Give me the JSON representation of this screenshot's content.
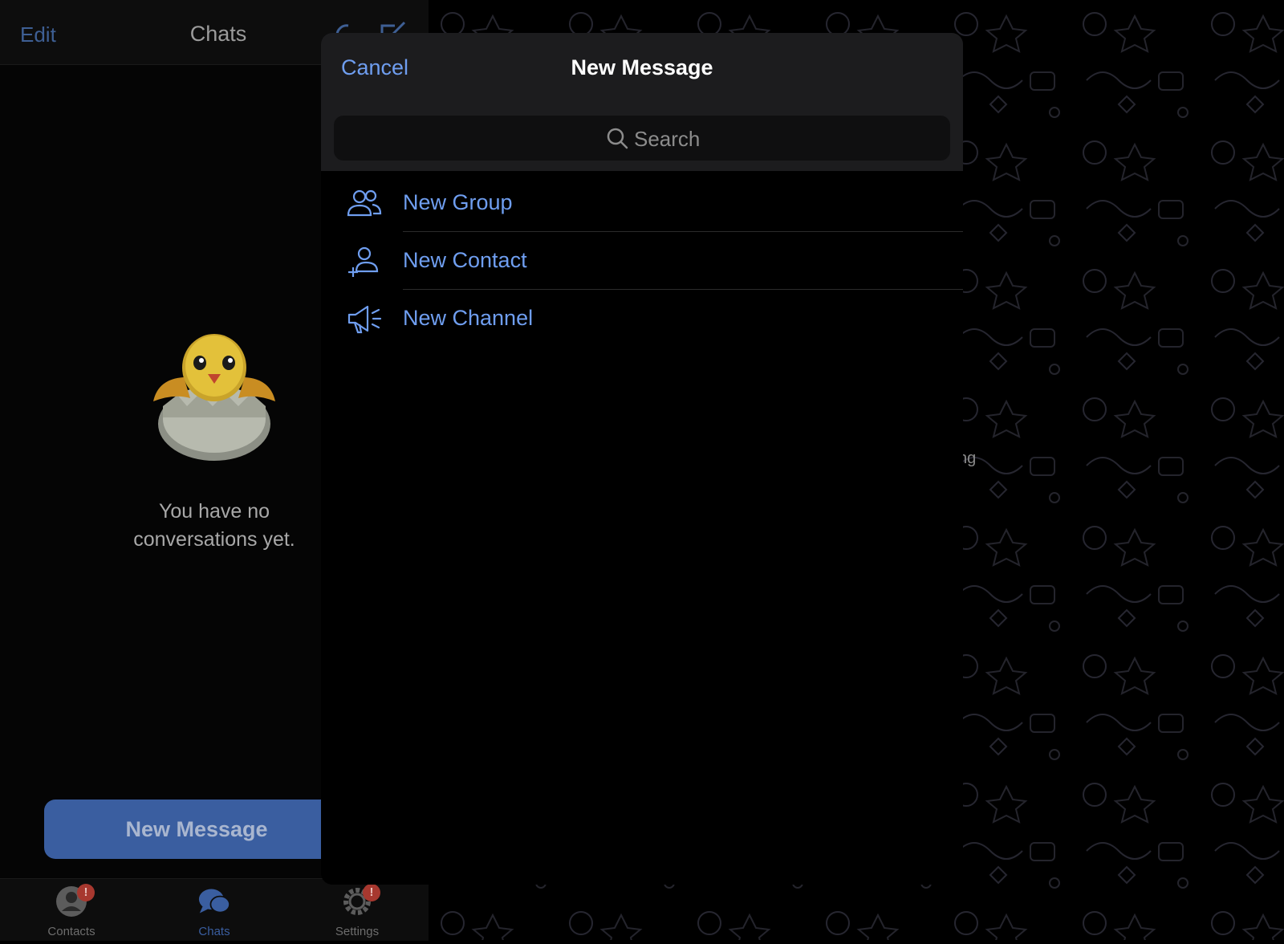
{
  "sidebar": {
    "edit_label": "Edit",
    "title": "Chats",
    "empty_message": "You have no conversations yet.",
    "new_message_label": "New Message"
  },
  "tabbar": {
    "tabs": [
      {
        "label": "Contacts",
        "icon": "person-icon",
        "badge": "!",
        "active": false
      },
      {
        "label": "Chats",
        "icon": "chat-bubbles-icon",
        "badge": "",
        "active": true
      },
      {
        "label": "Settings",
        "icon": "gear-icon",
        "badge": "!",
        "active": false
      }
    ]
  },
  "background": {
    "partial_text": "ng"
  },
  "modal": {
    "cancel_label": "Cancel",
    "title": "New Message",
    "search_placeholder": "Search",
    "items": [
      {
        "label": "New Group",
        "icon": "group-icon"
      },
      {
        "label": "New Contact",
        "icon": "add-contact-icon"
      },
      {
        "label": "New Channel",
        "icon": "megaphone-icon"
      }
    ]
  },
  "colors": {
    "accent": "#6f9ef0",
    "button": "#3a5ea0",
    "badge": "#a7382f"
  }
}
